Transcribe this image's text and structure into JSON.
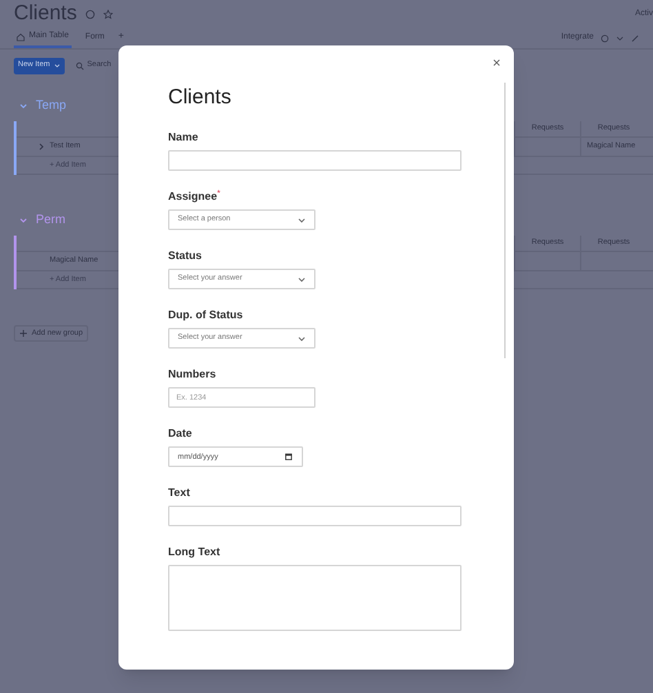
{
  "board": {
    "title": "Clients",
    "tabs": [
      {
        "label": "Main Table",
        "selected": true
      },
      {
        "label": "Form",
        "selected": false
      }
    ],
    "add_tab": "+",
    "integrate": "Integrate",
    "activity": "Activ",
    "new_item": "New Item",
    "search": "Search",
    "groups": [
      {
        "name": "Temp",
        "color": "#8aa8f5",
        "rows": [
          "Test Item"
        ],
        "right_rows": [
          "Magical Name"
        ],
        "add_item": "+ Add Item",
        "columns": [
          "Requests",
          "Requests"
        ]
      },
      {
        "name": "Perm",
        "color": "#b294ec",
        "rows": [
          "Magical Name"
        ],
        "right_rows": [
          ""
        ],
        "add_item": "+ Add Item",
        "columns": [
          "Requests",
          "Requests"
        ]
      }
    ],
    "add_group": "Add new group"
  },
  "modal": {
    "title": "Clients",
    "required_mark": "*",
    "fields": [
      {
        "kind": "text",
        "label": "Name",
        "required": false
      },
      {
        "kind": "select",
        "label": "Assignee",
        "required": true,
        "placeholder": "Select a person"
      },
      {
        "kind": "select",
        "label": "Status",
        "required": false,
        "placeholder": "Select your answer"
      },
      {
        "kind": "select",
        "label": "Dup. of Status",
        "required": false,
        "placeholder": "Select your answer"
      },
      {
        "kind": "number",
        "label": "Numbers",
        "required": false,
        "placeholder": "Ex. 1234"
      },
      {
        "kind": "date",
        "label": "Date",
        "required": false,
        "placeholder": "mm/dd/yyyy"
      },
      {
        "kind": "text",
        "label": "Text",
        "required": false
      },
      {
        "kind": "textarea",
        "label": "Long Text",
        "required": false
      }
    ]
  }
}
